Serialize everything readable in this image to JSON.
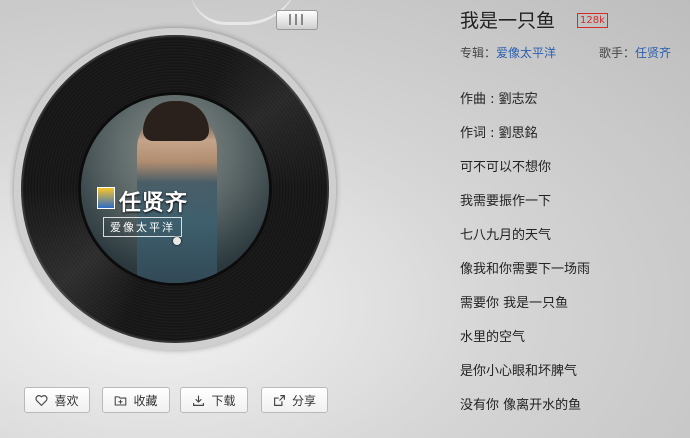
{
  "song": {
    "title": "我是一只鱼",
    "quality": "128k",
    "album_label": "专辑：",
    "album": "爱像太平洋",
    "singer_label": "歌手：",
    "singer": "任贤齐"
  },
  "cover": {
    "artist_text": "任贤齐",
    "album_text": "爱像太平洋"
  },
  "lyrics": [
    "作曲 : 劉志宏",
    "作词 : 劉思銘",
    "可不可以不想你",
    "我需要振作一下",
    "七八九月的天气",
    "像我和你需要下一场雨",
    "需要你 我是一只鱼",
    "水里的空气",
    "是你小心眼和坏脾气",
    "没有你 像离开水的鱼"
  ],
  "actions": {
    "like": "喜欢",
    "collect": "收藏",
    "download": "下载",
    "share": "分享"
  },
  "colors": {
    "accent_link": "#2a5fb0",
    "quality_badge": "#d62b2b"
  }
}
